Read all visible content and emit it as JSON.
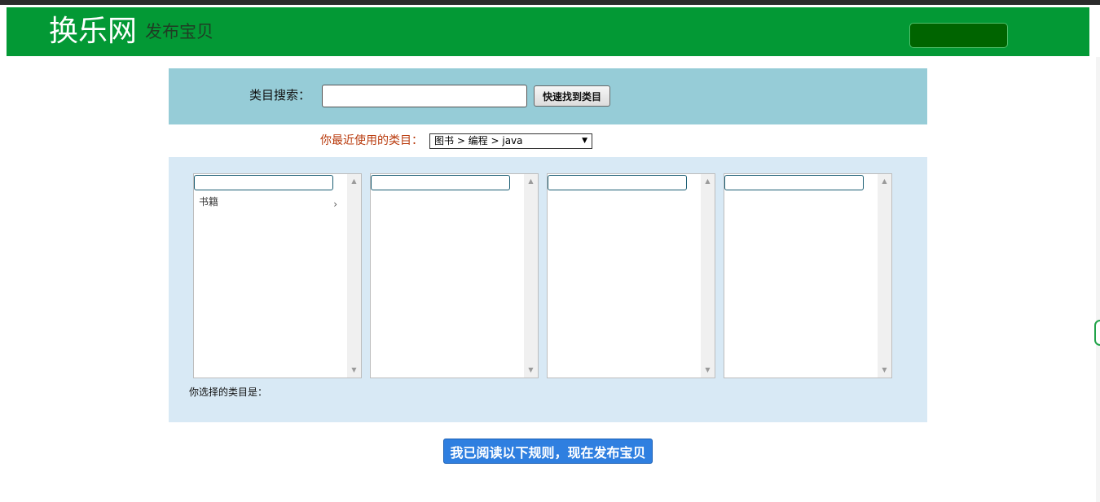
{
  "header": {
    "brand": "换乐网",
    "subtitle": "发布宝贝",
    "bg_color": "#039935",
    "button_color": "#006400"
  },
  "search": {
    "label": "类目搜索：",
    "value": "",
    "placeholder": "",
    "button_label": "快速找到类目",
    "panel_color": "#96ccd7"
  },
  "recent": {
    "label": "你最近使用的类目：",
    "selected": "图书 > 编程 > java",
    "dropdown_arrow": "▼"
  },
  "categories": {
    "panel_color": "#d8e9f5",
    "columns": [
      {
        "filter_value": "",
        "items": [
          {
            "label": "书籍",
            "icon": "chevron-right-icon",
            "glyph": "›"
          }
        ]
      },
      {
        "filter_value": "",
        "items": []
      },
      {
        "filter_value": "",
        "items": []
      },
      {
        "filter_value": "",
        "items": []
      }
    ],
    "scroll_up_glyph": "▲",
    "scroll_down_glyph": "▼",
    "selected_label": "你选择的类目是："
  },
  "publish": {
    "label": "我已阅读以下规则，现在发布宝贝",
    "color": "#2f7fe0"
  }
}
